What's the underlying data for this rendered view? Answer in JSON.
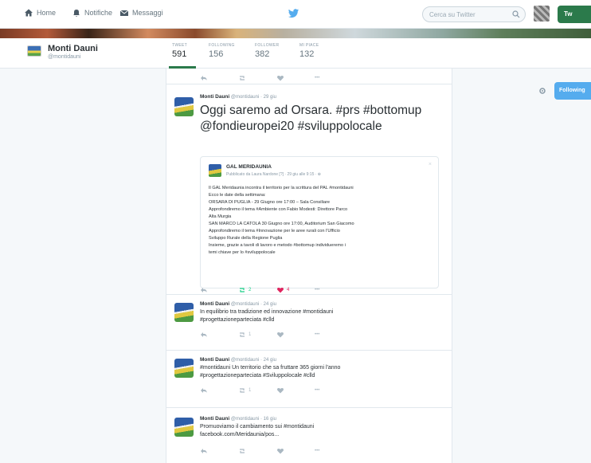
{
  "nav": {
    "home": "Home",
    "notifications": "Notifiche",
    "messages": "Messaggi",
    "search_placeholder": "Cerca su Twitter",
    "tweet_button": "Tw"
  },
  "profile": {
    "name": "Monti Dauni",
    "handle": "@montidauni",
    "follow_button": "Following",
    "stats": [
      {
        "label": "TWEET",
        "value": "591"
      },
      {
        "label": "FOLLOWING",
        "value": "156"
      },
      {
        "label": "FOLLOWER",
        "value": "382"
      },
      {
        "label": "MI PIACE",
        "value": "132"
      }
    ]
  },
  "tweets": [
    {
      "author": "Monti Dauni",
      "handle": "@montidauni · 29 giu",
      "text": "Oggi saremo ad Orsara. #prs #bottomup @fondieuropei20 #sviluppolocale",
      "retweets": "",
      "likes": "",
      "card": {
        "name": "GAL MERIDAUNIA",
        "meta": "Pubblicato da Laura Nardone [?] · 29 giu alle 9:15 · ⊕",
        "lines": [
          "Il GAL Meridaunia incontra il territorio per la scrittura del PAL #montidauni",
          "Ecco le date della settimana:",
          "ORSARA DI PUGLIA - 29 Giugno ore 17:00 – Sala Consiliare",
          "Approfondiremo il tema #Ambiente con Fabio Modesti: Direttore Parco",
          "Alta Murgia",
          "SAN MARCO LA CATOLA 30 Giugno ore 17:00, Auditorium San Giacomo",
          "Approfondiremo il tema #Innovazione per le aree rurali con l'Ufficio",
          "Sviluppo Rurale della Regione Puglia",
          "Insieme, grazie a tavoli di lavoro e metodo #bottomup individueremo i",
          "temi chiave per lo #sviluppolocale"
        ]
      },
      "card_retweets": "2",
      "card_likes": "4"
    },
    {
      "author": "Monti Dauni",
      "handle": "@montidauni · 24 giu",
      "line1": "In equilibrio tra tradizione ed innovazione #montidauni",
      "line2": "#progettazioneparteciata #clld",
      "retweets": "1"
    },
    {
      "author": "Monti Dauni",
      "handle": "@montidauni · 24 giu",
      "line1": "#montidauni Un territorio che sa fruttare 365 giorni l'anno",
      "line2": "#progettazioneparteciata #Sviluppolocale #clld",
      "retweets": "1"
    },
    {
      "author": "Monti Dauni",
      "handle": "@montidauni · 16 giu",
      "line1": "Promuoviamo il cambiamento sui #montidauni",
      "line2": "facebook.com/Meridaunia/pos..."
    }
  ],
  "colors": {
    "accent": "#55acee",
    "brand_green": "#2b7a4b",
    "like": "#e0245e",
    "retweet": "#19cf86"
  }
}
